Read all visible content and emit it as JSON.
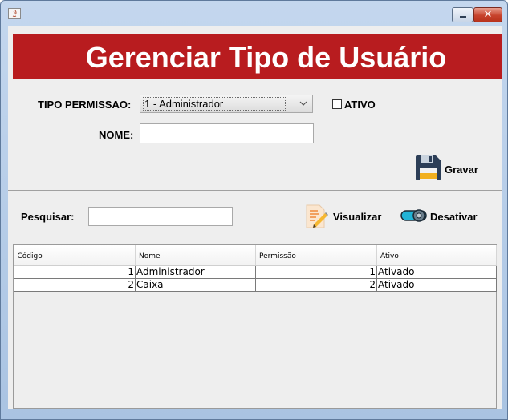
{
  "window": {
    "title": "",
    "controls": [
      "minimize",
      "close"
    ],
    "close_symbol": "✕"
  },
  "header": {
    "title": "Gerenciar Tipo de Usuário",
    "background_color": "#b81c1f",
    "text_color": "#ffffff"
  },
  "form": {
    "tipo_permissao_label": "TIPO PERMISSAO:",
    "tipo_permissao_selected": "1 - Administrador",
    "ativo_label": "ATIVO",
    "ativo_checked": false,
    "nome_label": "NOME:",
    "nome_value": "",
    "gravar_label": "Gravar",
    "gravar_icon": "floppy-disk-icon"
  },
  "search": {
    "label": "Pesquisar:",
    "value": "",
    "visualizar_label": "Visualizar",
    "visualizar_icon": "document-edit-icon",
    "desativar_label": "Desativar",
    "desativar_icon": "toggle-switch-icon"
  },
  "table": {
    "columns": [
      "Código",
      "Nome",
      "Permissão",
      "Ativo"
    ],
    "rows": [
      [
        "1",
        "Administrador",
        "1",
        "Ativado"
      ],
      [
        "2",
        "Caixa",
        "2",
        "Ativado"
      ]
    ]
  }
}
